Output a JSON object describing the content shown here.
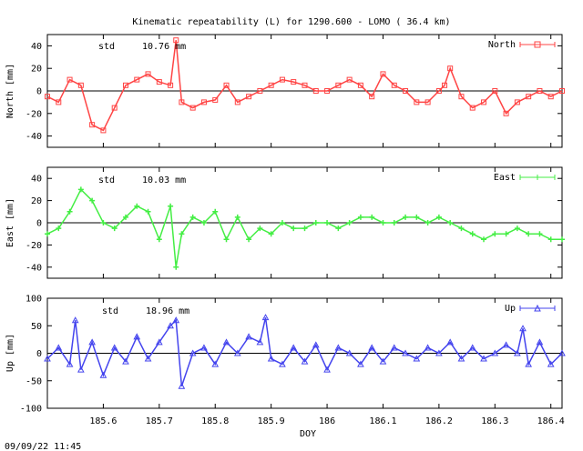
{
  "title": "Kinematic repeatability (L) for 1290.600 - LOMO  ( 36.4 km)",
  "xlabel": "DOY",
  "footer_timestamp": "09/09/22 11:45",
  "chart_data": [
    {
      "type": "line",
      "ylabel": "North [mm]",
      "ylim": [
        -50,
        50
      ],
      "yticks": [
        -40,
        -20,
        0,
        20,
        40
      ],
      "xlim": [
        185.5,
        186.42
      ],
      "std_label": "std",
      "std_value": "10.76 mm",
      "color": "#ff4444",
      "marker": "square",
      "legend_position": "top-right",
      "series": [
        {
          "name": "North",
          "x": [
            185.5,
            185.52,
            185.54,
            185.56,
            185.58,
            185.6,
            185.62,
            185.64,
            185.66,
            185.68,
            185.7,
            185.72,
            185.73,
            185.74,
            185.76,
            185.78,
            185.8,
            185.82,
            185.84,
            185.86,
            185.88,
            185.9,
            185.92,
            185.94,
            185.96,
            185.98,
            186.0,
            186.02,
            186.04,
            186.06,
            186.08,
            186.1,
            186.12,
            186.14,
            186.16,
            186.18,
            186.2,
            186.21,
            186.22,
            186.24,
            186.26,
            186.28,
            186.3,
            186.32,
            186.34,
            186.36,
            186.38,
            186.4,
            186.42
          ],
          "y": [
            -5,
            -10,
            10,
            5,
            -30,
            -35,
            -15,
            5,
            10,
            15,
            8,
            5,
            45,
            -10,
            -15,
            -10,
            -8,
            5,
            -10,
            -5,
            0,
            5,
            10,
            8,
            5,
            0,
            0,
            5,
            10,
            5,
            -5,
            15,
            5,
            0,
            -10,
            -10,
            0,
            5,
            20,
            -5,
            -15,
            -10,
            0,
            -20,
            -10,
            -5,
            0,
            -5,
            0
          ]
        }
      ]
    },
    {
      "type": "line",
      "ylabel": "East [mm]",
      "ylim": [
        -50,
        50
      ],
      "yticks": [
        -40,
        -20,
        0,
        20,
        40
      ],
      "xlim": [
        185.5,
        186.42
      ],
      "std_label": "std",
      "std_value": "10.03 mm",
      "color": "#44ee44",
      "marker": "plus",
      "legend_position": "top-right",
      "series": [
        {
          "name": "East",
          "x": [
            185.5,
            185.52,
            185.54,
            185.56,
            185.58,
            185.6,
            185.62,
            185.64,
            185.66,
            185.68,
            185.7,
            185.72,
            185.73,
            185.74,
            185.76,
            185.78,
            185.8,
            185.82,
            185.84,
            185.86,
            185.88,
            185.9,
            185.92,
            185.94,
            185.96,
            185.98,
            186.0,
            186.02,
            186.04,
            186.06,
            186.08,
            186.1,
            186.12,
            186.14,
            186.16,
            186.18,
            186.2,
            186.22,
            186.24,
            186.26,
            186.28,
            186.3,
            186.32,
            186.34,
            186.36,
            186.38,
            186.4,
            186.42
          ],
          "y": [
            -10,
            -5,
            10,
            30,
            20,
            0,
            -5,
            5,
            15,
            10,
            -15,
            15,
            -40,
            -10,
            5,
            0,
            10,
            -15,
            5,
            -15,
            -5,
            -10,
            0,
            -5,
            -5,
            0,
            0,
            -5,
            0,
            5,
            5,
            0,
            0,
            5,
            5,
            0,
            5,
            0,
            -5,
            -10,
            -15,
            -10,
            -10,
            -5,
            -10,
            -10,
            -15,
            -15
          ]
        }
      ]
    },
    {
      "type": "line",
      "ylabel": "Up [mm]",
      "ylim": [
        -100,
        100
      ],
      "yticks": [
        -100,
        -50,
        0,
        50,
        100
      ],
      "xlim": [
        185.5,
        186.42
      ],
      "std_label": "std",
      "std_value": "18.96 mm",
      "color": "#4444ee",
      "marker": "triangle",
      "legend_position": "top-right",
      "series": [
        {
          "name": "Up",
          "x": [
            185.5,
            185.52,
            185.54,
            185.55,
            185.56,
            185.58,
            185.6,
            185.62,
            185.64,
            185.66,
            185.68,
            185.7,
            185.72,
            185.73,
            185.74,
            185.76,
            185.78,
            185.8,
            185.82,
            185.84,
            185.86,
            185.88,
            185.89,
            185.9,
            185.92,
            185.94,
            185.96,
            185.98,
            186.0,
            186.02,
            186.04,
            186.06,
            186.08,
            186.1,
            186.12,
            186.14,
            186.16,
            186.18,
            186.2,
            186.22,
            186.24,
            186.26,
            186.28,
            186.3,
            186.32,
            186.34,
            186.35,
            186.36,
            186.38,
            186.4,
            186.42
          ],
          "y": [
            -10,
            10,
            -20,
            60,
            -30,
            20,
            -40,
            10,
            -15,
            30,
            -10,
            20,
            50,
            60,
            -60,
            0,
            10,
            -20,
            20,
            0,
            30,
            20,
            65,
            -10,
            -20,
            10,
            -15,
            15,
            -30,
            10,
            0,
            -20,
            10,
            -15,
            10,
            0,
            -10,
            10,
            0,
            20,
            -10,
            10,
            -10,
            0,
            15,
            0,
            45,
            -20,
            20,
            -20,
            0
          ]
        }
      ]
    }
  ],
  "x_ticks": [
    "185.6",
    "185.7",
    "185.8",
    "185.9",
    "186",
    "186.1",
    "186.2",
    "186.3",
    "186.4"
  ]
}
